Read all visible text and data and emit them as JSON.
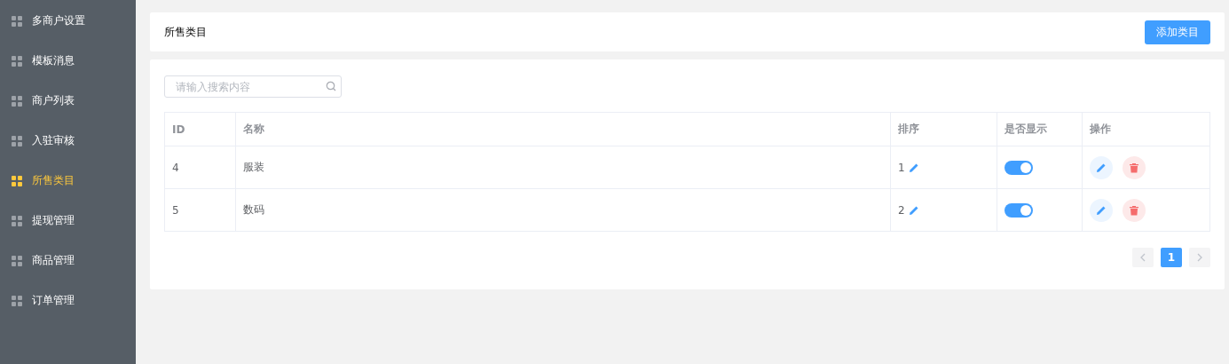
{
  "sidebar": {
    "items": [
      {
        "label": "多商户设置",
        "selected": false
      },
      {
        "label": "模板消息",
        "selected": false
      },
      {
        "label": "商户列表",
        "selected": false
      },
      {
        "label": "入驻审核",
        "selected": false
      },
      {
        "label": "所售类目",
        "selected": true
      },
      {
        "label": "提现管理",
        "selected": false
      },
      {
        "label": "商品管理",
        "selected": false
      },
      {
        "label": "订单管理",
        "selected": false
      }
    ]
  },
  "header": {
    "title": "所售类目",
    "add_button": "添加类目"
  },
  "search": {
    "placeholder": "请输入搜索内容"
  },
  "table": {
    "columns": [
      "ID",
      "名称",
      "排序",
      "是否显示",
      "操作"
    ],
    "rows": [
      {
        "id": "4",
        "name": "服装",
        "sort": "1",
        "visible": true
      },
      {
        "id": "5",
        "name": "数码",
        "sort": "2",
        "visible": true
      }
    ]
  },
  "pagination": {
    "pages": [
      {
        "label": "1",
        "selected": true
      }
    ]
  }
}
